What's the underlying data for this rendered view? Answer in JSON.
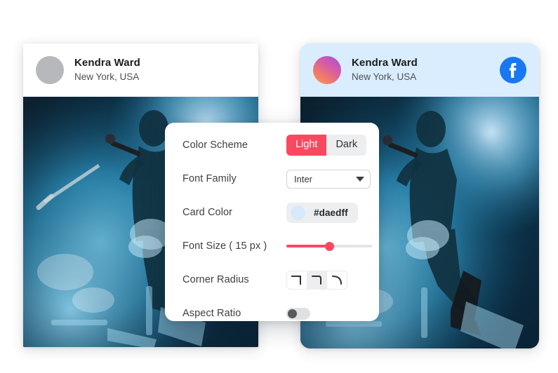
{
  "cards": [
    {
      "id": "left",
      "name": "Kendra Ward",
      "location": "New York, USA",
      "avatar_icon": "avatar-placeholder-icon",
      "header_bg": "#ffffff",
      "corner_style": "square"
    },
    {
      "id": "right",
      "name": "Kendra Ward",
      "location": "New York, USA",
      "avatar_icon": "avatar-gradient-icon",
      "social_icon": "facebook-icon",
      "header_bg": "#daedff",
      "corner_style": "rounded"
    }
  ],
  "photo": {
    "alt": "concert-performer-photo",
    "description": "Singer performing on stage with microphone amid blue stage smoke"
  },
  "settings": {
    "color_scheme": {
      "label": "Color Scheme",
      "options": [
        "Light",
        "Dark"
      ],
      "selected": "Light",
      "accent": "#f9485f"
    },
    "font_family": {
      "label": "Font Family",
      "value": "Inter",
      "caret_icon": "chevron-down-icon"
    },
    "card_color": {
      "label": "Card Color",
      "value": "#daedff",
      "swatch_icon": "color-swatch-icon"
    },
    "font_size": {
      "label": "Font Size ( 15 px )",
      "value": 15,
      "percent": 50
    },
    "corner_radius": {
      "label": "Corner Radius",
      "options": [
        "corner-sharp-icon",
        "corner-small-icon",
        "corner-large-icon"
      ],
      "selected_index": 1
    },
    "aspect_ratio": {
      "label": "Aspect Ratio",
      "enabled": false
    }
  }
}
